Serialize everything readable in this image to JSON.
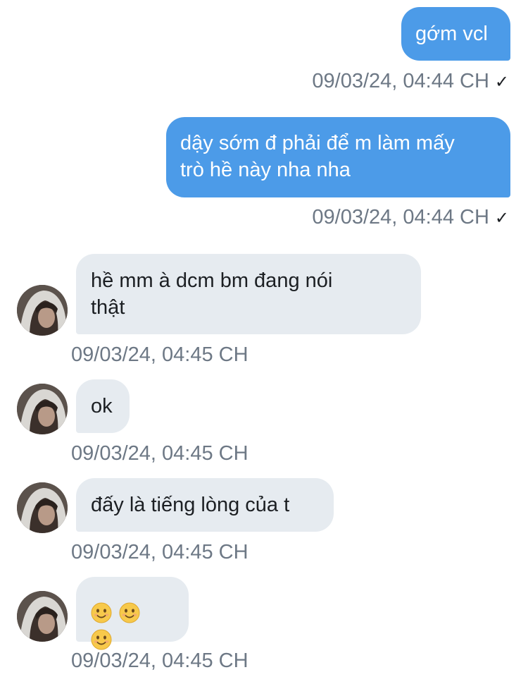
{
  "messages": [
    {
      "direction": "outgoing",
      "text": "gớm vcl",
      "timestamp": "09/03/24, 04:44 CH",
      "status": "✓"
    },
    {
      "direction": "outgoing",
      "text_lines": [
        "dậy sớm đ phải để m làm mấy",
        "trò hề này nha nha"
      ],
      "timestamp": "09/03/24, 04:44 CH",
      "status": "✓"
    },
    {
      "direction": "incoming",
      "text_lines": [
        "hề mm à dcm bm đang nói",
        "thật"
      ],
      "timestamp": "09/03/24, 04:45 CH"
    },
    {
      "direction": "incoming",
      "text": "ok",
      "timestamp": "09/03/24, 04:45 CH"
    },
    {
      "direction": "incoming",
      "text": "đấy là tiếng lòng của t",
      "timestamp": "09/03/24, 04:45 CH"
    },
    {
      "direction": "incoming",
      "emojis": [
        "smiling-face-emoji",
        "smiling-face-emoji",
        "smiling-face-emoji"
      ],
      "timestamp": "09/03/24, 04:45 CH"
    }
  ],
  "colors": {
    "outgoing_bubble": "#4c9be8",
    "incoming_bubble": "#e6ebf0",
    "timestamp": "#6d7885"
  }
}
